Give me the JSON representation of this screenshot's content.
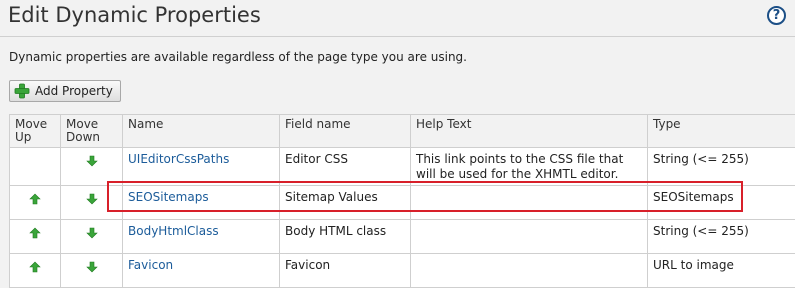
{
  "header": {
    "title": "Edit Dynamic Properties",
    "help_glyph": "?"
  },
  "description": "Dynamic properties are available regardless of the page type you are using.",
  "add_button": {
    "label": "Add Property",
    "icon": "plus-icon"
  },
  "table": {
    "columns": {
      "move_up": [
        "Move",
        "Up"
      ],
      "move_down": [
        "Move",
        "Down"
      ],
      "name": "Name",
      "field_name": "Field name",
      "help_text": "Help Text",
      "type": "Type"
    },
    "rows": [
      {
        "name": "UIEditorCssPaths",
        "field_name": "Editor CSS",
        "help_text": "This link points to the CSS file that will be used for the XHMTL editor.",
        "type": "String (<= 255)",
        "can_move_up": false,
        "can_move_down": true
      },
      {
        "name": "SEOSitemaps",
        "field_name": "Sitemap Values",
        "help_text": "",
        "type": "SEOSitemaps",
        "can_move_up": true,
        "can_move_down": true,
        "highlighted": true
      },
      {
        "name": "BodyHtmlClass",
        "field_name": "Body HTML class",
        "help_text": "",
        "type": "String (<= 255)",
        "can_move_up": true,
        "can_move_down": true
      },
      {
        "name": "Favicon",
        "field_name": "Favicon",
        "help_text": "",
        "type": "URL to image",
        "can_move_up": true,
        "can_move_down": true
      }
    ]
  },
  "colors": {
    "link": "#1c5c9a",
    "arrow_green": "#3aa53a",
    "highlight_border": "#d8202a"
  }
}
